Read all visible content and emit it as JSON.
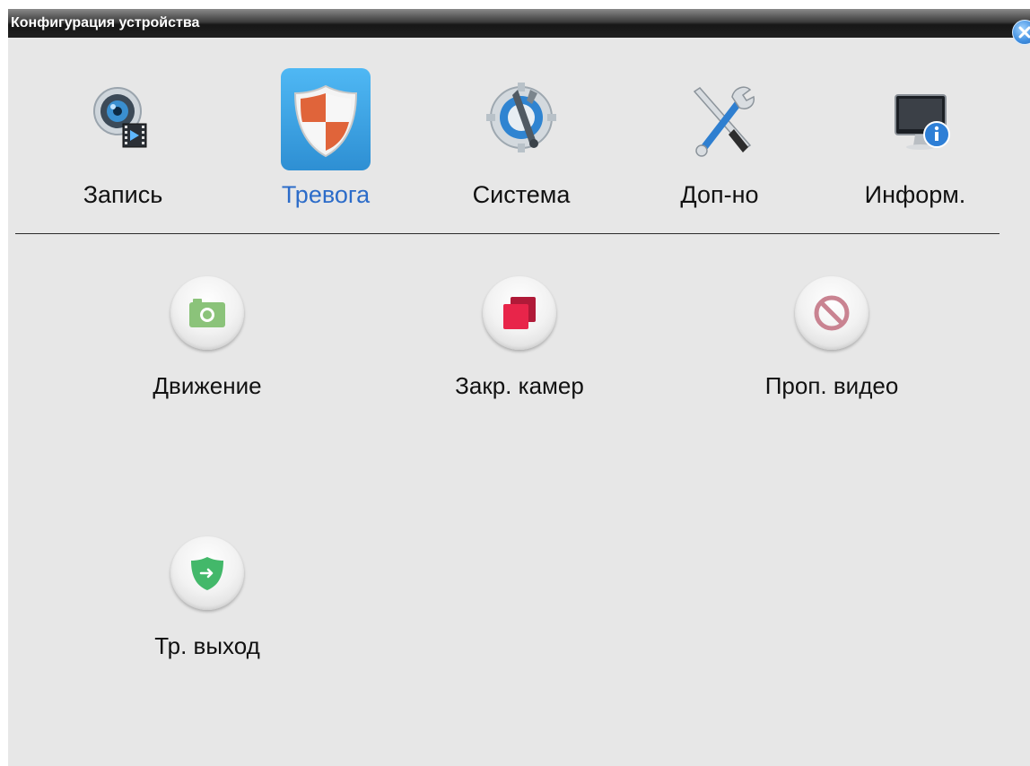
{
  "window": {
    "title": "Конфигурация устройства"
  },
  "tabs": [
    {
      "label": "Запись",
      "icon": "record-camera-icon"
    },
    {
      "label": "Тревога",
      "icon": "alarm-shield-icon",
      "active": true
    },
    {
      "label": "Система",
      "icon": "system-gear-icon"
    },
    {
      "label": "Доп-но",
      "icon": "tools-icon"
    },
    {
      "label": "Информ.",
      "icon": "info-monitor-icon"
    }
  ],
  "items": [
    {
      "label": "Движение",
      "icon": "camera-icon"
    },
    {
      "label": "Закр. камер",
      "icon": "overlap-squares-icon"
    },
    {
      "label": "Проп. видео",
      "icon": "no-video-icon"
    },
    {
      "label": "Тр. выход",
      "icon": "shield-output-icon"
    }
  ],
  "colors": {
    "active_tab_text": "#2c6cc9",
    "background": "#e7e7e7",
    "camera_green": "#8bc37a",
    "square_red": "#e8254a",
    "novideo_pink": "#c98391",
    "shield_green": "#43b86a"
  }
}
